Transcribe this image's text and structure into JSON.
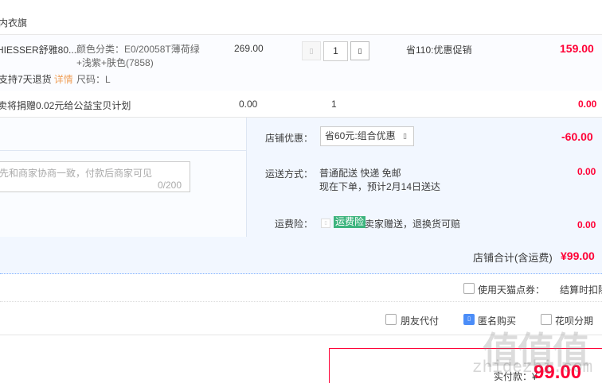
{
  "shop": {
    "name": "内衣旗"
  },
  "item": {
    "title": "HIESSER舒雅80...",
    "promise": "支持7天退货",
    "detail_link": "详情",
    "sku_color_line1": "颜色分类：E0/20058T薄荷绿",
    "sku_color_line2": "+浅紫+肤色(7858)",
    "sku_size": "尺码：L",
    "unit_price": "269.00",
    "qty_minus_icon": "minus-icon",
    "quantity": "1",
    "qty_plus_icon": "plus-icon",
    "promotion": "省110:优惠促销",
    "total": "159.00"
  },
  "charity": {
    "text": "卖将捐赠0.02元给公益宝贝计划",
    "unit_price": "0.00",
    "quantity": "1",
    "total": "0.00"
  },
  "memo": {
    "placeholder": "先和商家协商一致，付款后商家可见",
    "counter": "0/200"
  },
  "discount": {
    "label": "店铺优惠：",
    "selected": "省60元:组合优惠",
    "amount": "-60.00"
  },
  "shipping": {
    "label": "运送方式：",
    "method": "普通配送 快递 免邮",
    "eta": "现在下单，预计2月14日送达",
    "amount": "0.00"
  },
  "insurance": {
    "label": "运费险：",
    "badge": "运费险",
    "desc": "卖家赠送，退换货可赔",
    "amount": "0.00"
  },
  "shop_total": {
    "label": "店铺合计(含运费)",
    "value": "¥99.00"
  },
  "points": {
    "label": "使用天猫点券：",
    "value": "结算时扣除"
  },
  "options": {
    "friend_pay": "朋友代付",
    "anonymous": "匿名购买",
    "huabei": "花呗分期"
  },
  "payment": {
    "label": "实付款：¥",
    "value": "99.00"
  },
  "watermark": {
    "chars": "值值值",
    "url": "zhidezhi.com"
  },
  "colors": {
    "accent_red": "#ff0036",
    "link_orange": "#f0a15b",
    "badge_green": "#3db47e",
    "checkbox_blue": "#4b8df8"
  }
}
